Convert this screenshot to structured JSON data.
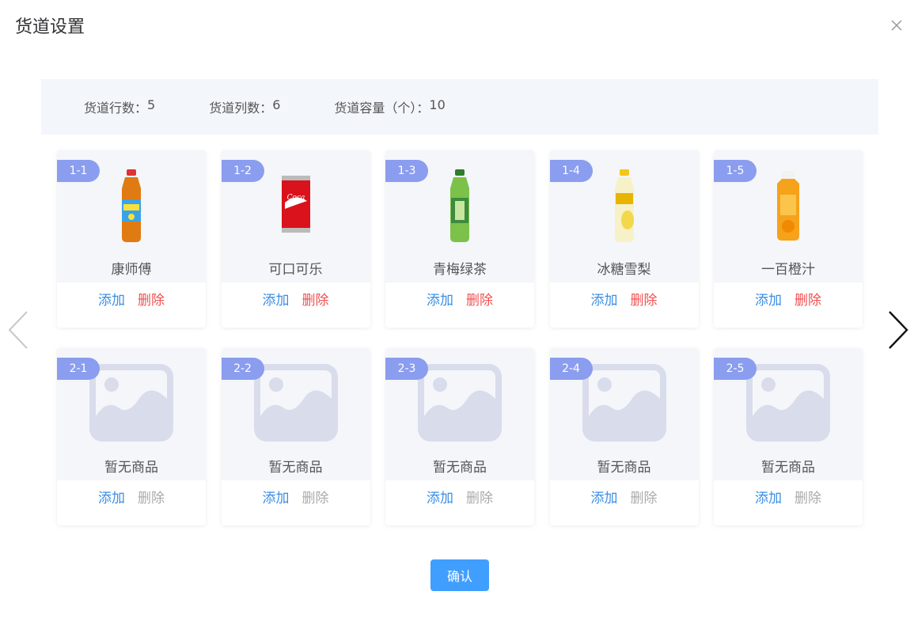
{
  "dialog": {
    "title": "货道设置",
    "confirm_label": "确认"
  },
  "info": [
    {
      "label": "货道行数：",
      "value": "5"
    },
    {
      "label": "货道列数：",
      "value": "6"
    },
    {
      "label": "货道容量（个）：",
      "value": "10"
    }
  ],
  "actions": {
    "add_label": "添加",
    "delete_label": "删除"
  },
  "rows": [
    [
      {
        "code": "1-1",
        "name": "康师傅",
        "image": "iced-tea-bottle-icon"
      },
      {
        "code": "1-2",
        "name": "可口可乐",
        "image": "cola-can-icon"
      },
      {
        "code": "1-3",
        "name": "青梅绿茶",
        "image": "green-tea-bottle-icon"
      },
      {
        "code": "1-4",
        "name": "冰糖雪梨",
        "image": "pear-juice-bottle-icon"
      },
      {
        "code": "1-5",
        "name": "一百橙汁",
        "image": "orange-juice-bottle-icon"
      }
    ],
    [
      {
        "code": "2-1",
        "name": "暂无商品",
        "image": "image-placeholder-icon"
      },
      {
        "code": "2-2",
        "name": "暂无商品",
        "image": "image-placeholder-icon"
      },
      {
        "code": "2-3",
        "name": "暂无商品",
        "image": "image-placeholder-icon"
      },
      {
        "code": "2-4",
        "name": "暂无商品",
        "image": "image-placeholder-icon"
      },
      {
        "code": "2-5",
        "name": "暂无商品",
        "image": "image-placeholder-icon"
      }
    ]
  ],
  "colors": {
    "accent": "#409eff",
    "tag": "#8b9def",
    "delete": "#f05050",
    "disabled": "#aaaaaa",
    "link": "#3a8ee6"
  }
}
